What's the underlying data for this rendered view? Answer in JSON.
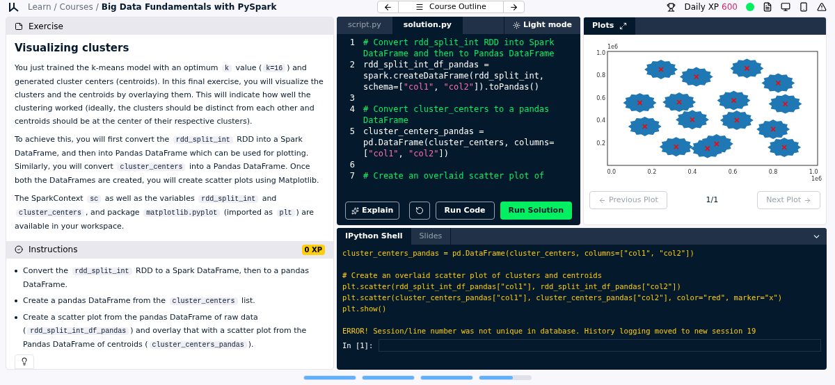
{
  "breadcrumb": {
    "separator": "/",
    "items": [
      "Learn",
      "Courses",
      "Big Data Fundamentals with PySpark"
    ]
  },
  "course_nav": {
    "label": "Course Outline"
  },
  "daily_xp": {
    "label": "Daily XP",
    "value": "600"
  },
  "exercise": {
    "header": "Exercise",
    "title": "Visualizing clusters",
    "paragraphs": [
      [
        {
          "kind": "text",
          "text": "You just trained the k-means model with an optimum "
        },
        {
          "kind": "code",
          "text": "k"
        },
        {
          "kind": "text",
          "text": " value ("
        },
        {
          "kind": "code",
          "text": "k=16"
        },
        {
          "kind": "text",
          "text": ") and generated cluster centers (centroids). In this final exercise, you will visualize the clusters and the centroids by overlaying them. This will indicate how well the clustering worked (ideally, the clusters should be distinct from each other and centroids should be at the center of their respective clusters)."
        }
      ],
      [
        {
          "kind": "text",
          "text": "To achieve this, you will first convert the "
        },
        {
          "kind": "code",
          "text": "rdd_split_int"
        },
        {
          "kind": "text",
          "text": " RDD into a Spark DataFrame, and then into Pandas DataFrame which can be used for plotting. Similarly, you will convert "
        },
        {
          "kind": "code",
          "text": "cluster_centers"
        },
        {
          "kind": "text",
          "text": " into a Pandas DataFrame. Once both the DataFrames are created, you will create scatter plots using Matplotlib."
        }
      ],
      [
        {
          "kind": "text",
          "text": "The SparkContext "
        },
        {
          "kind": "code",
          "text": "sc"
        },
        {
          "kind": "text",
          "text": " as well as the variables "
        },
        {
          "kind": "code",
          "text": "rdd_split_int"
        },
        {
          "kind": "text",
          "text": " and "
        },
        {
          "kind": "code",
          "text": "cluster_centers"
        },
        {
          "kind": "text",
          "text": ", and package "
        },
        {
          "kind": "code",
          "text": "matplotlib.pyplot"
        },
        {
          "kind": "text",
          "text": " (imported as "
        },
        {
          "kind": "code",
          "text": "plt"
        },
        {
          "kind": "text",
          "text": ") are available in your workspace."
        }
      ]
    ]
  },
  "instructions": {
    "header": "Instructions",
    "xp": "0 XP",
    "items": [
      [
        {
          "kind": "text",
          "text": "Convert the "
        },
        {
          "kind": "code",
          "text": "rdd_split_int"
        },
        {
          "kind": "text",
          "text": " RDD to a Spark DataFrame, then to a pandas DataFrame."
        }
      ],
      [
        {
          "kind": "text",
          "text": "Create a pandas DataFrame from the "
        },
        {
          "kind": "code",
          "text": "cluster_centers"
        },
        {
          "kind": "text",
          "text": " list."
        }
      ],
      [
        {
          "kind": "text",
          "text": "Create a scatter plot from the pandas DataFrame of raw data ("
        },
        {
          "kind": "code",
          "text": "rdd_split_int_df_pandas"
        },
        {
          "kind": "text",
          "text": ") and overlay that with a scatter plot from the Pandas DataFrame of centroids ("
        },
        {
          "kind": "code",
          "text": "cluster_centers_pandas"
        },
        {
          "kind": "text",
          "text": ")."
        }
      ]
    ]
  },
  "editor": {
    "tabs": [
      {
        "label": "script.py",
        "selected": false
      },
      {
        "label": "solution.py",
        "selected": true
      }
    ],
    "theme_toggle": "Light mode",
    "lines": [
      {
        "number": "1",
        "parts": [
          {
            "kind": "comment",
            "text": "# Convert rdd_split_int RDD into Spark DataFrame and then to Pandas DataFrame"
          }
        ]
      },
      {
        "number": "2",
        "parts": [
          {
            "kind": "plain",
            "text": "rdd_split_int_df_pandas = spark.createDataFrame(rdd_split_int, schema=["
          },
          {
            "kind": "string",
            "text": "\"col1\""
          },
          {
            "kind": "plain",
            "text": ", "
          },
          {
            "kind": "string",
            "text": "\"col2\""
          },
          {
            "kind": "plain",
            "text": "]).toPandas()"
          }
        ]
      },
      {
        "number": "3"
      },
      {
        "number": "4",
        "parts": [
          {
            "kind": "comment",
            "text": "# Convert cluster_centers to a pandas DataFrame"
          }
        ]
      },
      {
        "number": "5",
        "parts": [
          {
            "kind": "plain",
            "text": "cluster_centers_pandas = pd.DataFrame(cluster_centers, columns=["
          },
          {
            "kind": "string",
            "text": "\"col1\""
          },
          {
            "kind": "plain",
            "text": ", "
          },
          {
            "kind": "string",
            "text": "\"col2\""
          },
          {
            "kind": "plain",
            "text": "])"
          }
        ]
      },
      {
        "number": "6"
      },
      {
        "number": "7",
        "parts": [
          {
            "kind": "comment",
            "text": "# Create an overlaid scatter plot of"
          }
        ]
      }
    ],
    "buttons": {
      "explain": "Explain",
      "run": "Run Code",
      "submit": "Run Solution"
    }
  },
  "plots": {
    "tab": "Plots",
    "prev": "Previous Plot",
    "next": "Next Plot",
    "counter": "1/1",
    "chart_data": {
      "type": "scatter",
      "xlim": [
        -0.02,
        1.02
      ],
      "ylim": [
        0,
        1.01
      ],
      "xticks": [
        {
          "value": 0,
          "label": "0.0"
        },
        {
          "value": 0.2,
          "label": "0.2"
        },
        {
          "value": 0.4,
          "label": "0.4"
        },
        {
          "value": 0.6,
          "label": "0.6"
        },
        {
          "value": 0.8,
          "label": "0.8"
        },
        {
          "value": 1,
          "label": "1.0"
        }
      ],
      "yticks": [
        {
          "value": 0.2,
          "label": "0.2"
        },
        {
          "value": 0.4,
          "label": "0.4"
        },
        {
          "value": 0.6,
          "label": "0.6"
        },
        {
          "value": 0.8,
          "label": "0.8"
        },
        {
          "value": 1,
          "label": "1.0"
        }
      ],
      "annotations": [
        "1e6",
        "1e6"
      ],
      "series": [
        {
          "color": "#ff0000",
          "x": [
            0.245,
            0.42,
            0.67,
            0.825,
            0.14,
            0.335,
            0.605,
            0.86,
            0.165,
            0.4,
            0.62,
            0.8,
            0.32,
            0.475,
            0.52,
            0.855
          ],
          "values": [
            0.85,
            0.785,
            0.86,
            0.73,
            0.555,
            0.56,
            0.575,
            0.545,
            0.345,
            0.405,
            0.4,
            0.32,
            0.165,
            0.15,
            0.19,
            0.16
          ]
        }
      ]
    }
  },
  "shell": {
    "tabs": [
      {
        "label": "IPython Shell",
        "selected": true
      },
      {
        "label": "Slides",
        "selected": false
      }
    ],
    "lines": [
      {
        "kind": "output",
        "text": "cluster_centers_pandas = pd.DataFrame(cluster_centers, columns=[\"col1\", \"col2\"])"
      },
      {
        "kind": "blank"
      },
      {
        "kind": "output",
        "text": "# Create an overlaid scatter plot of clusters and centroids"
      },
      {
        "kind": "output",
        "text": "plt.scatter(rdd_split_int_df_pandas[\"col1\"], rdd_split_int_df_pandas[\"col2\"])"
      },
      {
        "kind": "output",
        "text": "plt.scatter(cluster_centers_pandas[\"col1\"], cluster_centers_pandas[\"col2\"], color=\"red\", marker=\"x\")"
      },
      {
        "kind": "output",
        "text": "plt.show()"
      },
      {
        "kind": "blank"
      },
      {
        "kind": "output",
        "text": "ERROR! Session/line number was not unique in database. History logging moved to new session 19"
      }
    ],
    "prompt": "In [1]:"
  },
  "progress": [
    {
      "level": 1
    },
    {
      "level": 1
    },
    {
      "level": 1
    },
    {
      "level": 0.65
    }
  ]
}
